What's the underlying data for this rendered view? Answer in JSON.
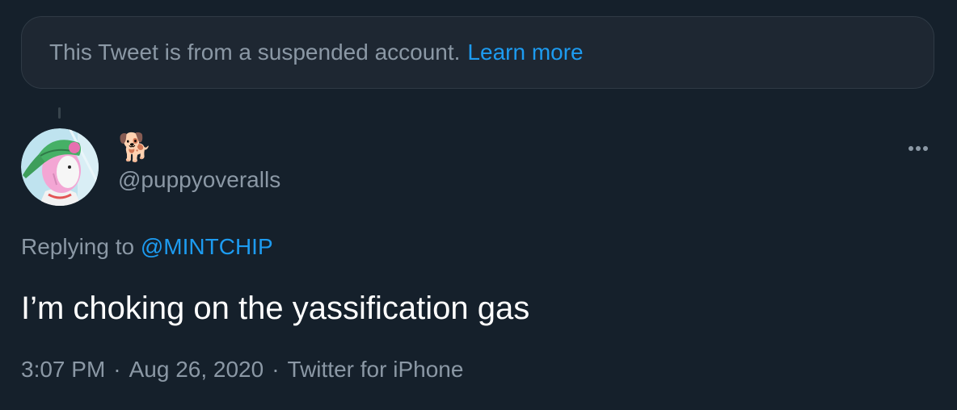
{
  "notice": {
    "text": "This Tweet is from a suspended account.",
    "link": "Learn more"
  },
  "author": {
    "display_name": "🐕",
    "handle": "@puppyoveralls",
    "avatar_icon": "cartoon-character-avatar"
  },
  "reply_context": {
    "prefix": "Replying to",
    "mention": "@MINTCHIP"
  },
  "tweet": {
    "text": "I’m choking on the yassification gas"
  },
  "meta": {
    "time": "3:07 PM",
    "separator": "·",
    "date": "Aug 26, 2020",
    "source": "Twitter for iPhone"
  },
  "colors": {
    "background": "#15202b",
    "notice_background": "#1e2732",
    "accent": "#1d9bf0",
    "secondary_text": "#8b98a5",
    "primary_text": "#ffffff"
  }
}
